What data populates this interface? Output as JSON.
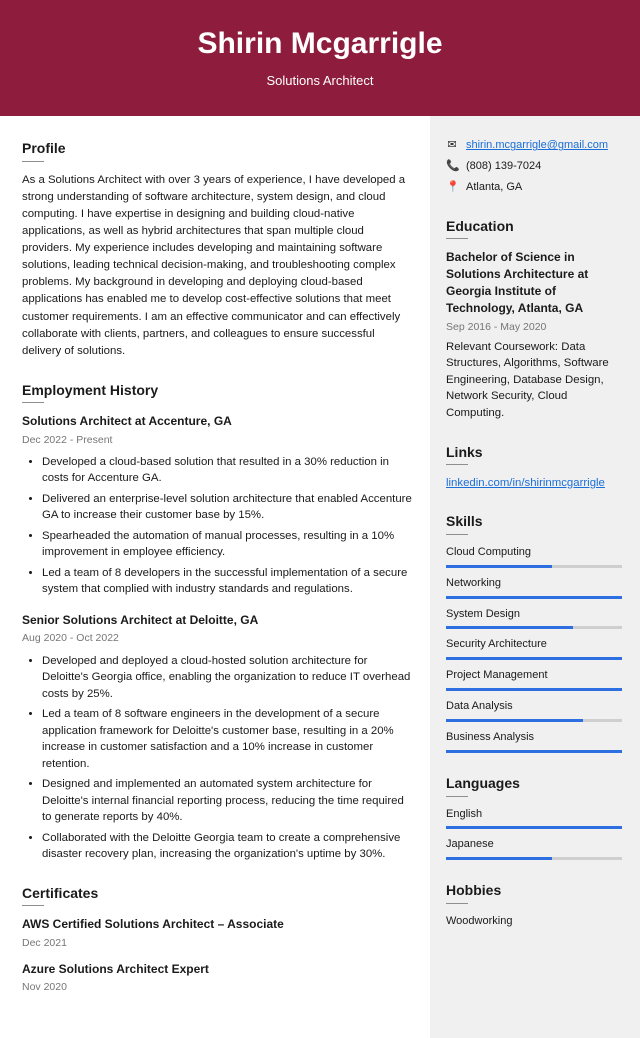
{
  "header": {
    "name": "Shirin Mcgarrigle",
    "title": "Solutions Architect"
  },
  "profile": {
    "heading": "Profile",
    "text": "As a Solutions Architect with over 3 years of experience, I have developed a strong understanding of software architecture, system design, and cloud computing. I have expertise in designing and building cloud-native applications, as well as hybrid architectures that span multiple cloud providers. My experience includes developing and maintaining software solutions, leading technical decision-making, and troubleshooting complex problems. My background in developing and deploying cloud-based applications has enabled me to develop cost-effective solutions that meet customer requirements. I am an effective communicator and can effectively collaborate with clients, partners, and colleagues to ensure successful delivery of solutions."
  },
  "employment": {
    "heading": "Employment History",
    "jobs": [
      {
        "title": "Solutions Architect at Accenture, GA",
        "dates": "Dec 2022 - Present",
        "bullets": [
          "Developed a cloud-based solution that resulted in a 30% reduction in costs for Accenture GA.",
          "Delivered an enterprise-level solution architecture that enabled Accenture GA to increase their customer base by 15%.",
          "Spearheaded the automation of manual processes, resulting in a 10% improvement in employee efficiency.",
          "Led a team of 8 developers in the successful implementation of a secure system that complied with industry standards and regulations."
        ]
      },
      {
        "title": "Senior Solutions Architect at Deloitte, GA",
        "dates": "Aug 2020 - Oct 2022",
        "bullets": [
          "Developed and deployed a cloud-hosted solution architecture for Deloitte's Georgia office, enabling the organization to reduce IT overhead costs by 25%.",
          "Led a team of 8 software engineers in the development of a secure application framework for Deloitte's customer base, resulting in a 20% increase in customer satisfaction and a 10% increase in customer retention.",
          "Designed and implemented an automated system architecture for Deloitte's internal financial reporting process, reducing the time required to generate reports by 40%.",
          "Collaborated with the Deloitte Georgia team to create a comprehensive disaster recovery plan, increasing the organization's uptime by 30%."
        ]
      }
    ]
  },
  "certificates": {
    "heading": "Certificates",
    "items": [
      {
        "title": "AWS Certified Solutions Architect – Associate",
        "date": "Dec 2021"
      },
      {
        "title": "Azure Solutions Architect Expert",
        "date": "Nov 2020"
      }
    ]
  },
  "contact": {
    "email": "shirin.mcgarrigle@gmail.com",
    "phone": "(808) 139-7024",
    "location": "Atlanta, GA"
  },
  "education": {
    "heading": "Education",
    "title": "Bachelor of Science in Solutions Architecture at Georgia Institute of Technology, Atlanta, GA",
    "dates": "Sep 2016 - May 2020",
    "desc": "Relevant Coursework: Data Structures, Algorithms, Software Engineering, Database Design, Network Security, Cloud Computing."
  },
  "links": {
    "heading": "Links",
    "url": "linkedin.com/in/shirinmcgarrigle"
  },
  "skills": {
    "heading": "Skills",
    "items": [
      {
        "name": "Cloud Computing",
        "level": 60
      },
      {
        "name": "Networking",
        "level": 100
      },
      {
        "name": "System Design",
        "level": 72
      },
      {
        "name": "Security Architecture",
        "level": 100
      },
      {
        "name": "Project Management",
        "level": 100
      },
      {
        "name": "Data Analysis",
        "level": 78
      },
      {
        "name": "Business Analysis",
        "level": 100
      }
    ]
  },
  "languages": {
    "heading": "Languages",
    "items": [
      {
        "name": "English",
        "level": 100
      },
      {
        "name": "Japanese",
        "level": 60
      }
    ]
  },
  "hobbies": {
    "heading": "Hobbies",
    "items": [
      "Woodworking"
    ]
  }
}
